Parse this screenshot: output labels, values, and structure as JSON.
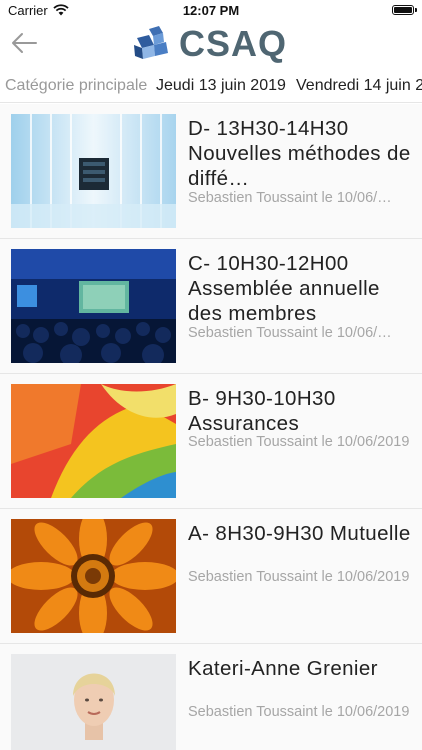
{
  "status_bar": {
    "carrier": "Carrier",
    "time": "12:07 PM"
  },
  "header": {
    "logo_text": "CSAQ"
  },
  "tabs": [
    {
      "label": "Catégorie principale"
    },
    {
      "label": "Jeudi 13 juin 2019"
    },
    {
      "label": "Vendredi 14 juin 2"
    }
  ],
  "articles": [
    {
      "title": "D- 13H30-14H30 Nouvelles méthodes de diffé…",
      "meta": "Sebastien Toussaint le 10/06/…",
      "thumb": "server-room-image"
    },
    {
      "title": "C- 10H30-12H00 Assemblée annuelle des membres",
      "meta": "Sebastien Toussaint le 10/06/…",
      "thumb": "conference-audience-image"
    },
    {
      "title": "B- 9H30-10H30 Assurances",
      "meta": "Sebastien Toussaint le 10/06/2019",
      "thumb": "colorful-swirl-image"
    },
    {
      "title": "A- 8H30-9H30 Mutuelle",
      "meta": "Sebastien Toussaint le 10/06/2019",
      "thumb": "orange-flower-image"
    },
    {
      "title": "Kateri-Anne Grenier",
      "meta": "Sebastien Toussaint le 10/06/2019",
      "thumb": "portrait-photo"
    }
  ]
}
